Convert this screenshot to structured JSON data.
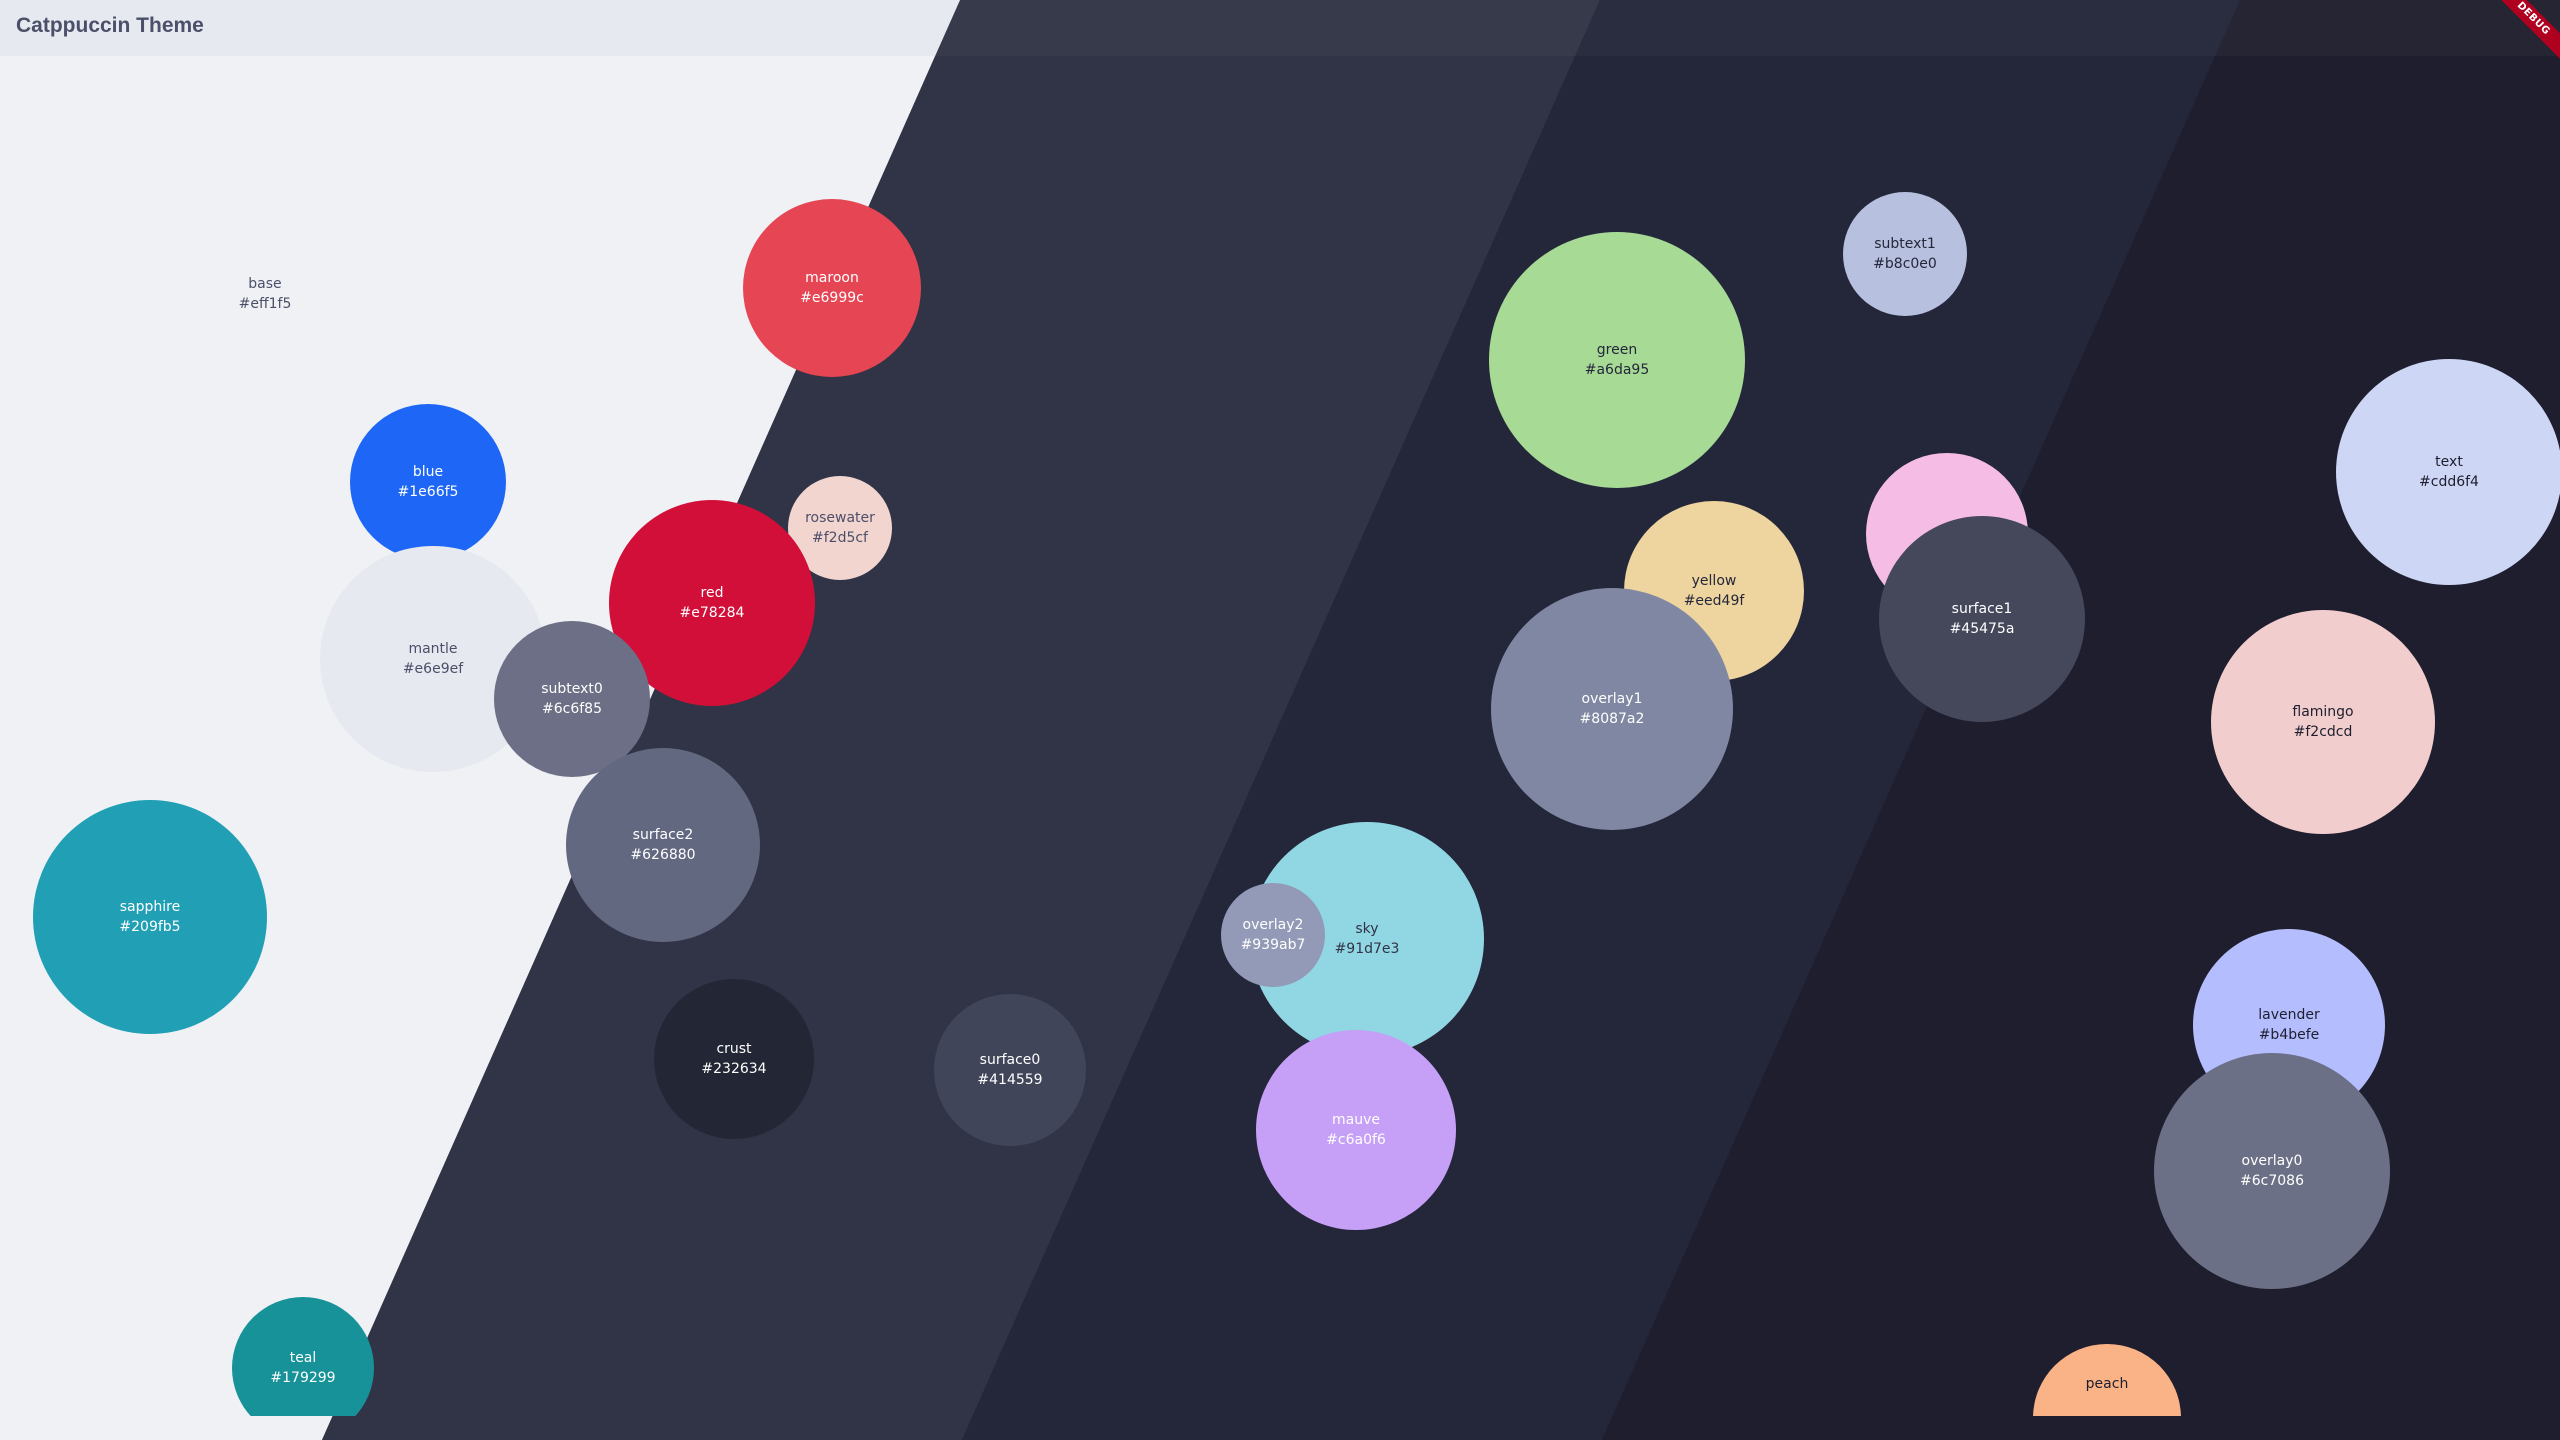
{
  "app": {
    "title": "Catppuccin Theme",
    "debug_label": "DEBUG"
  },
  "colors": {
    "latte": "#eff1f5",
    "frappe": "#303446",
    "macchiato": "#24273a",
    "mocha": "#1e1e2e"
  },
  "swatches": [
    {
      "name": "base",
      "hex": "#eff1f5",
      "fill": "#eff1f5",
      "text_color": "#4c4f69"
    },
    {
      "name": "maroon",
      "hex": "#e6999c",
      "fill": "#e64553",
      "text_color": "#ffffff"
    },
    {
      "name": "blue",
      "hex": "#1e66f5",
      "fill": "#1e66f5",
      "text_color": "#ffffff"
    },
    {
      "name": "rosewater",
      "hex": "#f2d5cf",
      "fill": "#f2d5cf",
      "text_color": "#4c4f69"
    },
    {
      "name": "red",
      "hex": "#e78284",
      "fill": "#d20f39",
      "text_color": "#ffffff"
    },
    {
      "name": "mantle",
      "hex": "#e6e9ef",
      "fill": "#e6e9ef",
      "text_color": "#4c4f69"
    },
    {
      "name": "subtext0",
      "hex": "#6c6f85",
      "fill": "#6c6f85",
      "text_color": "#ffffff"
    },
    {
      "name": "surface2",
      "hex": "#626880",
      "fill": "#626880",
      "text_color": "#ffffff"
    },
    {
      "name": "sapphire",
      "hex": "#209fb5",
      "fill": "#209fb5",
      "text_color": "#ffffff"
    },
    {
      "name": "crust",
      "hex": "#232634",
      "fill": "#232634",
      "text_color": "#ffffff"
    },
    {
      "name": "surface0",
      "hex": "#414559",
      "fill": "#414559",
      "text_color": "#ffffff"
    },
    {
      "name": "teal",
      "hex": "#179299",
      "fill": "#179299",
      "text_color": "#ffffff"
    },
    {
      "name": "sky",
      "hex": "#91d7e3",
      "fill": "#91d7e3",
      "text_color": "#303446"
    },
    {
      "name": "overlay2",
      "hex": "#939ab7",
      "fill": "#939ab7",
      "text_color": "#ffffff"
    },
    {
      "name": "mauve",
      "hex": "#c6a0f6",
      "fill": "#c6a0f6",
      "text_color": "#ffffff"
    },
    {
      "name": "green",
      "hex": "#a6da95",
      "fill": "#a6da95",
      "text_color": "#24273a"
    },
    {
      "name": "yellow",
      "hex": "#eed49f",
      "fill": "#eed49f",
      "text_color": "#24273a"
    },
    {
      "name": "overlay1",
      "hex": "#8087a2",
      "fill": "#8087a2",
      "text_color": "#ffffff"
    },
    {
      "name": "subtext1",
      "hex": "#b8c0e0",
      "fill": "#b8c0e0",
      "text_color": "#24273a"
    },
    {
      "name": "",
      "hex": "",
      "fill": "#f5bde6",
      "text_color": "#24273a"
    },
    {
      "name": "surface1",
      "hex": "#45475a",
      "fill": "#45475a",
      "text_color": "#ffffff"
    },
    {
      "name": "text",
      "hex": "#cdd6f4",
      "fill": "#cdd6f4",
      "text_color": "#1e1e2e"
    },
    {
      "name": "flamingo",
      "hex": "#f2cdcd",
      "fill": "#f2cdcd",
      "text_color": "#1e1e2e"
    },
    {
      "name": "lavender",
      "hex": "#b4befe",
      "fill": "#b4befe",
      "text_color": "#1e1e2e"
    },
    {
      "name": "overlay0",
      "hex": "#6c7086",
      "fill": "#6c7086",
      "text_color": "#ffffff"
    },
    {
      "name": "peach",
      "hex": "",
      "fill": "#fab387",
      "text_color": "#1e1e2e"
    }
  ]
}
